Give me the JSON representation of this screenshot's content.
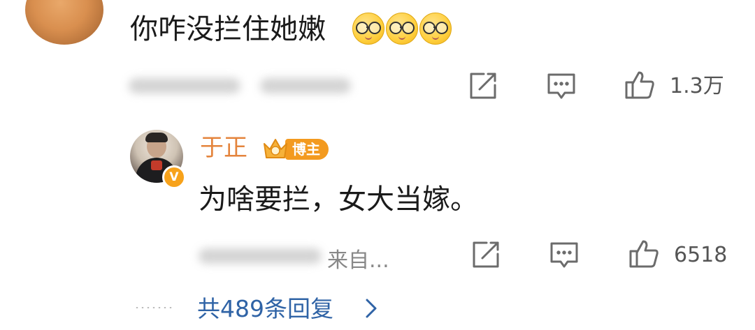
{
  "comment": {
    "text": "你咋没拦住她嫩",
    "emoji": [
      "glasses-emoji",
      "glasses-emoji",
      "glasses-emoji"
    ],
    "like_count": "1.3万"
  },
  "reply": {
    "author": "于正",
    "badge": "博主",
    "verified_mark": "V",
    "text": "为啥要拦，女大当嫁。",
    "source_partial": "来自...",
    "like_count": "6518"
  },
  "more_replies": {
    "label": "共489条回复"
  },
  "colors": {
    "name": "#e4843c",
    "badge": "#f39a1f",
    "link": "#2f63a6",
    "icon": "#6b6b6b"
  }
}
